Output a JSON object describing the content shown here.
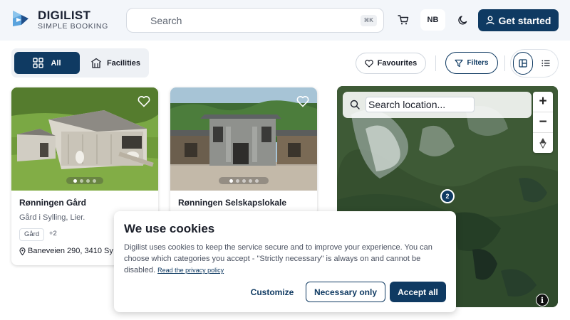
{
  "header": {
    "brand_name": "DIGILIST",
    "brand_sub": "SIMPLE BOOKING",
    "search_placeholder": "Search",
    "search_shortcut": "⌘K",
    "language": "NB",
    "cta_label": "Get started",
    "icons": [
      "logo-icon",
      "search-icon",
      "cart-icon",
      "moon-icon",
      "user-icon"
    ]
  },
  "filters": {
    "segments": [
      {
        "label": "All",
        "icon": "grid-icon",
        "selected": true
      },
      {
        "label": "Facilities",
        "icon": "building-icon",
        "selected": false
      }
    ],
    "favourites_label": "Favourites",
    "filters_label": "Filters",
    "view_modes": [
      "split-view",
      "list-view"
    ],
    "active_view": "split-view"
  },
  "listings": [
    {
      "title": "Rønningen Gård",
      "subtitle": "Gård i Sylling, Lier.",
      "tag": "Gård",
      "more_tags": "+2",
      "address": "Baneveien 290, 3410 Sy",
      "image_slides": 4,
      "active_slide": 1
    },
    {
      "title": "Rønningen Selskapslokale",
      "image_slides": 5,
      "active_slide": 1
    }
  ],
  "map": {
    "search_placeholder": "Search location...",
    "zoom_in": "+",
    "zoom_out": "−",
    "cluster_count": "2",
    "info": "i"
  },
  "cookie": {
    "title": "We use cookies",
    "body": "Digilist uses cookies to keep the service secure and to improve your experience. You can choose which categories you accept - \"Strictly necessary\" is always on and cannot be disabled.",
    "link": "Read the privacy policy",
    "customize": "Customize",
    "necessary_only": "Necessary only",
    "accept_all": "Accept all"
  },
  "colors": {
    "primary": "#0f3a62",
    "header_bg": "#f3f6fa"
  }
}
